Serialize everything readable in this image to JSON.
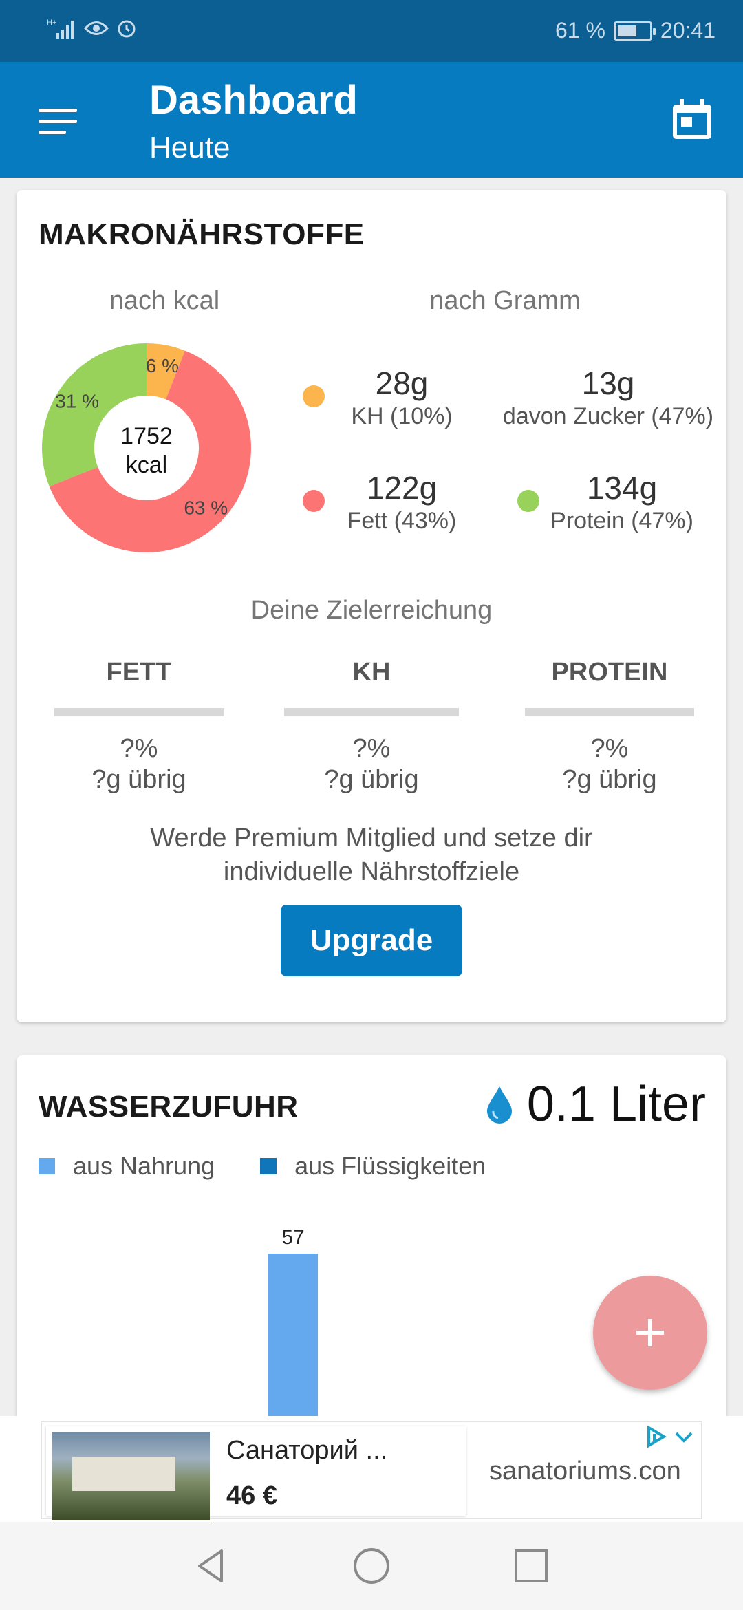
{
  "status_bar": {
    "battery_pct": "61 %",
    "battery_level": 0.61,
    "time": "20:41"
  },
  "app_bar": {
    "title": "Dashboard",
    "subtitle": "Heute"
  },
  "macros": {
    "section_title": "MAKRONÄHRSTOFFE",
    "by_kcal_label": "nach kcal",
    "by_gram_label": "nach Gramm",
    "donut_center_value": "1752",
    "donut_center_unit": "kcal",
    "donut_slices": [
      {
        "name": "Protein",
        "pct": 31,
        "label": "31 %",
        "color": "#99d25a"
      },
      {
        "name": "KH",
        "pct": 6,
        "label": "6 %",
        "color": "#fbb54c"
      },
      {
        "name": "Fett",
        "pct": 63,
        "label": "63 %",
        "color": "#fd7474"
      }
    ],
    "grams": {
      "kh": {
        "value": "28g",
        "label": "KH (10%)",
        "color": "#fbb54c"
      },
      "sugar": {
        "value": "13g",
        "label": "davon Zucker (47%)"
      },
      "fat": {
        "value": "122g",
        "label": "Fett (43%)",
        "color": "#fd7474"
      },
      "protein": {
        "value": "134g",
        "label": "Protein (47%)",
        "color": "#99d25a"
      }
    },
    "goal_heading": "Deine Zielerreichung",
    "goals": [
      {
        "name": "FETT",
        "pct": "?%",
        "remaining": "?g übrig"
      },
      {
        "name": "KH",
        "pct": "?%",
        "remaining": "?g übrig"
      },
      {
        "name": "PROTEIN",
        "pct": "?%",
        "remaining": "?g übrig"
      }
    ],
    "premium_line1": "Werde Premium Mitglied und setze dir",
    "premium_line2": "individuelle Nährstoffziele",
    "upgrade_label": "Upgrade"
  },
  "water": {
    "section_title": "WASSERZUFUHR",
    "amount": "0.1 Liter",
    "legend": [
      {
        "label": "aus Nahrung",
        "color": "#64a9ed"
      },
      {
        "label": "aus Flüssigkeiten",
        "color": "#1176b9"
      }
    ]
  },
  "chart_data": {
    "type": "bar",
    "series": [
      {
        "name": "aus Nahrung",
        "values": [
          57
        ]
      }
    ],
    "data_labels": [
      "57"
    ]
  },
  "fab": {
    "icon": "plus-icon"
  },
  "ad": {
    "title": "Санаторий ...",
    "price": "46 €",
    "url": "sanatoriums.con"
  },
  "nav": {
    "back_icon": "back-triangle-icon",
    "home_icon": "home-circle-icon",
    "recents_icon": "recents-square-icon"
  }
}
